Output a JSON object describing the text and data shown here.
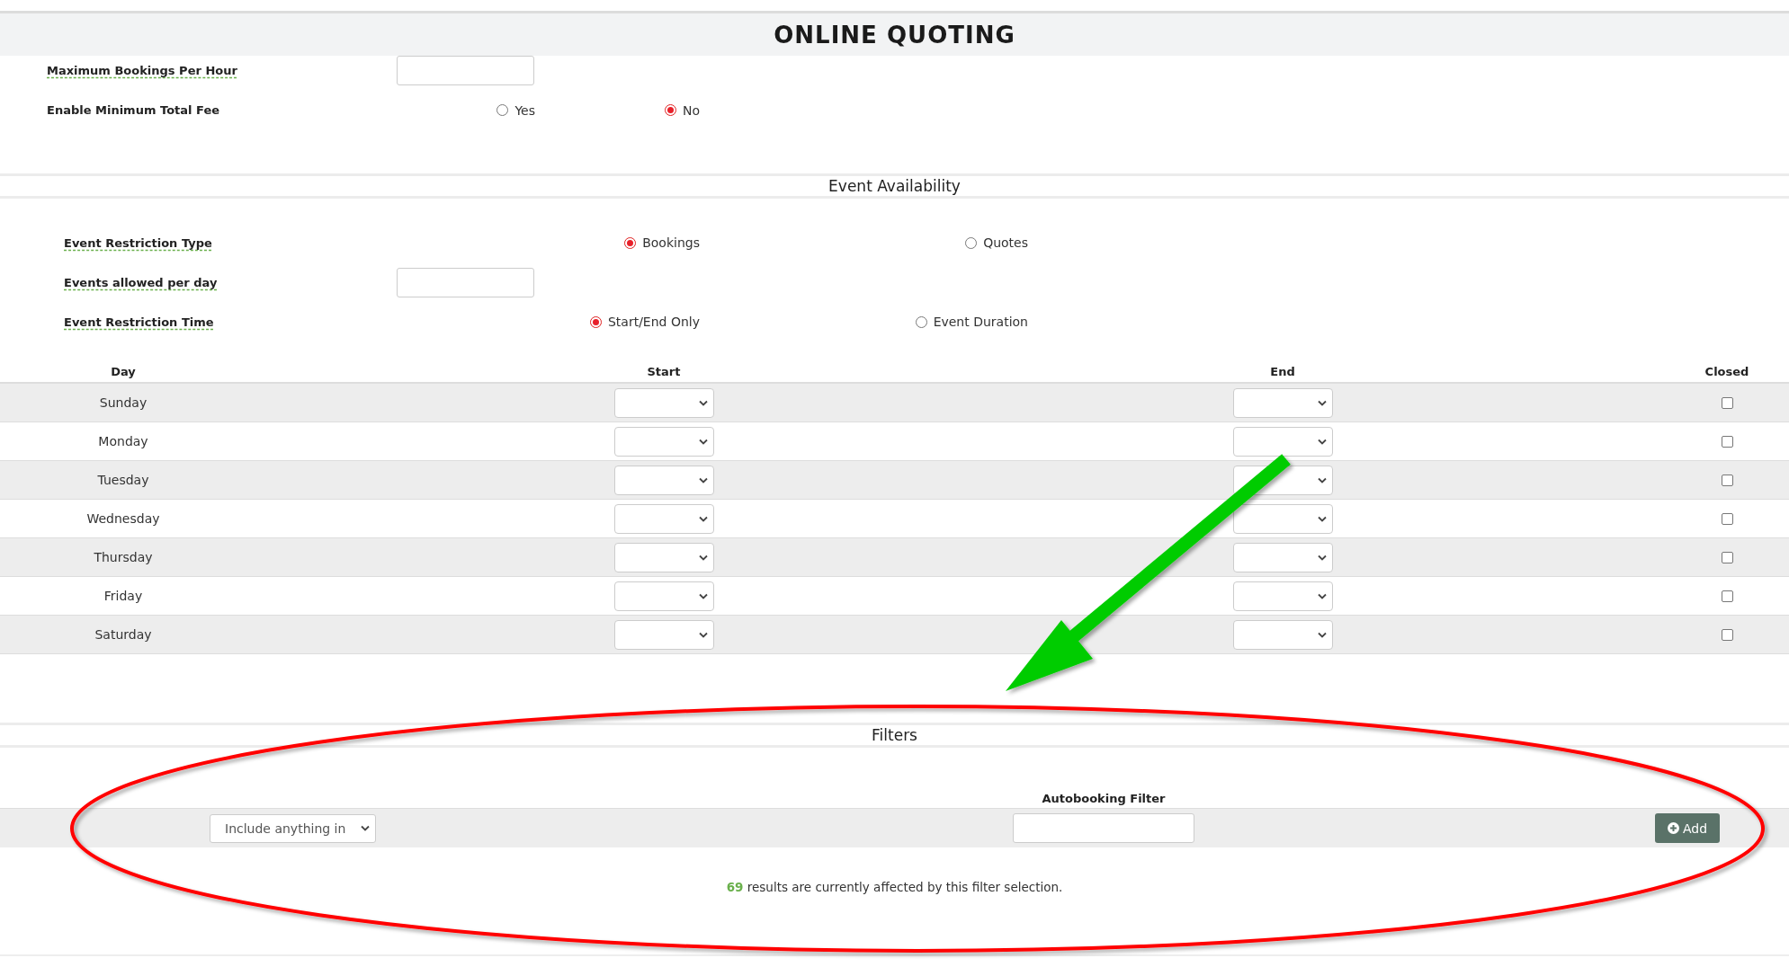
{
  "page_title": "ONLINE QUOTING",
  "sections": [
    {
      "fields": [
        {
          "kind": "text",
          "label": "Maximum Bookings Per Hour",
          "tooltip": true
        },
        {
          "kind": "radio",
          "label": "Enable Minimum Total Fee",
          "tooltip": false,
          "options": [
            {
              "label": "Yes",
              "selected": false
            },
            {
              "label": "No",
              "selected": true
            }
          ]
        }
      ]
    },
    {
      "heading": "Event Availability",
      "fields": [
        {
          "kind": "radio",
          "label": "Event Restriction Type",
          "tooltip": true,
          "options": [
            {
              "label": "Bookings",
              "selected": true
            },
            {
              "label": "Quotes",
              "selected": false
            }
          ]
        },
        {
          "kind": "text",
          "label": "Events allowed per day",
          "tooltip": true
        },
        {
          "kind": "radio",
          "label": "Event Restriction Time",
          "tooltip": true,
          "options": [
            {
              "label": "Start/End Only",
              "selected": true
            },
            {
              "label": "Event Duration",
              "selected": false
            }
          ]
        }
      ]
    }
  ],
  "schedule": {
    "columns": [
      "Day",
      "Start",
      "End",
      "Closed"
    ],
    "rows": [
      {
        "day": "Sunday",
        "closed": false
      },
      {
        "day": "Monday",
        "closed": false
      },
      {
        "day": "Tuesday",
        "closed": false
      },
      {
        "day": "Wednesday",
        "closed": false
      },
      {
        "day": "Thursday",
        "closed": false
      },
      {
        "day": "Friday",
        "closed": false
      },
      {
        "day": "Saturday",
        "closed": false
      }
    ]
  },
  "filters": {
    "heading": "Filters",
    "filter_label": "Autobooking Filter",
    "mode": "Include anything in",
    "add_button": "Add",
    "count": "69",
    "result_text": "results are currently affected by this filter selection."
  },
  "annotations": [
    {
      "kind": "ellipse",
      "color": "#ff0000"
    },
    {
      "kind": "arrow",
      "color": "#00cc00"
    }
  ]
}
